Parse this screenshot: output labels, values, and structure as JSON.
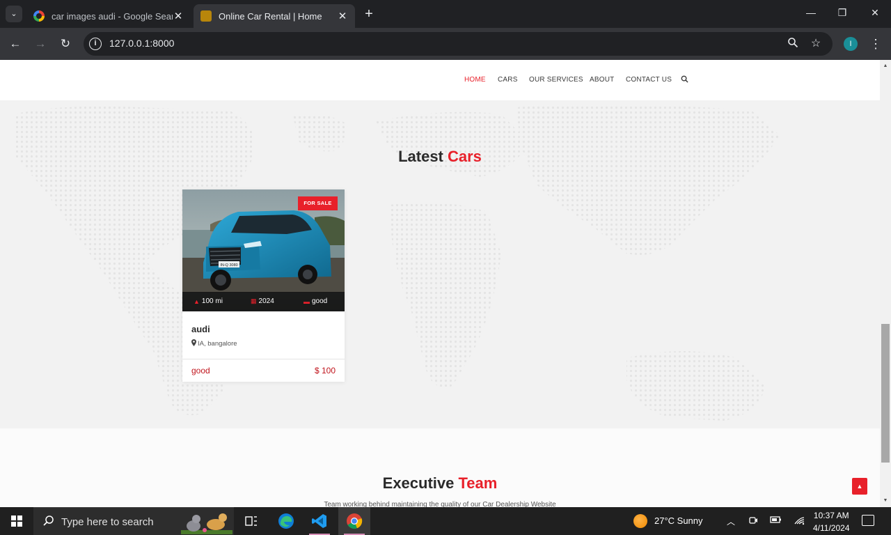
{
  "browser": {
    "tabs": [
      {
        "title": "car images audi - Google Search",
        "close": "✕"
      },
      {
        "title": "Online Car Rental | Home",
        "close": "✕"
      }
    ],
    "new_tab": "+",
    "tab_list": "⌄",
    "window_controls": {
      "minimize": "—",
      "restore": "❐",
      "close": "✕"
    },
    "url": "127.0.0.1:8000",
    "nav": {
      "back": "←",
      "forward": "→",
      "reload": "↻"
    },
    "profile_initial": "I",
    "menu": "⋮"
  },
  "site": {
    "nav_links": [
      "HOME",
      "CARS",
      "OUR SERVICES",
      "ABOUT",
      "CONTACT US"
    ],
    "active_nav": "HOME",
    "search_icon": "search-icon",
    "latest": {
      "title_main": "Latest",
      "title_accent": "Cars"
    },
    "car": {
      "badge": "FOR SALE",
      "mileage": "100 mi",
      "year": "2024",
      "condition_spec": "good",
      "name": "audi",
      "location": "IA, bangalore",
      "condition": "good",
      "price": "$ 100",
      "plate": "IN-Q 3080"
    },
    "team": {
      "title_main": "Executive",
      "title_accent": "Team",
      "subtitle": "Team working behind maintaining the quality of our Car Dealership Website"
    },
    "back_to_top": "▲"
  },
  "colors": {
    "accent": "#e8202a",
    "browser_dark": "#202124",
    "taskbar": "#202020"
  },
  "taskbar": {
    "search_placeholder": "Type here to search",
    "weather": "27°C  Sunny",
    "time": "10:37 AM",
    "date": "4/11/2024",
    "apps": [
      "task-view-icon",
      "edge-icon",
      "vscode-icon",
      "chrome-icon"
    ]
  }
}
